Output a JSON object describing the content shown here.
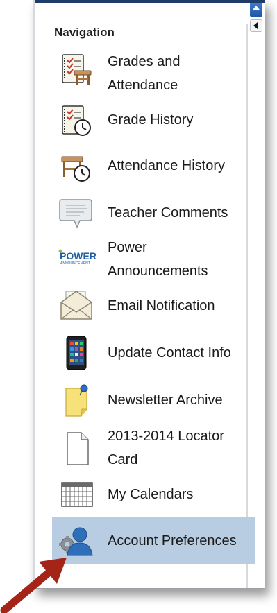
{
  "panel": {
    "title": "Navigation",
    "scroll_up_label": "",
    "items": [
      {
        "id": "grades-and-attendance",
        "icon": "gradebook-desk-icon",
        "label_line1": "Grades and",
        "label_line2": "Attendance"
      },
      {
        "id": "grade-history",
        "icon": "gradebook-clock-icon",
        "label": "Grade History"
      },
      {
        "id": "attendance-history",
        "icon": "desk-clock-icon",
        "label": "Attendance History"
      },
      {
        "id": "teacher-comments",
        "icon": "speech-note-icon",
        "label": "Teacher Comments"
      },
      {
        "id": "power-announcements",
        "icon": "power-announcement-logo-icon",
        "label_line1": "Power",
        "label_line2": "Announcements",
        "logo_text": "POWER",
        "logo_subtext": "ANNOUNCEMENT"
      },
      {
        "id": "email-notification",
        "icon": "envelope-icon",
        "label": "Email Notification"
      },
      {
        "id": "update-contact-info",
        "icon": "smartphone-icon",
        "label": "Update Contact Info"
      },
      {
        "id": "newsletter-archive",
        "icon": "sticky-note-pin-icon",
        "label": "Newsletter Archive"
      },
      {
        "id": "locator-card",
        "icon": "blank-document-icon",
        "label_line1": "2013-2014 Locator",
        "label_line2": "Card"
      },
      {
        "id": "my-calendars",
        "icon": "calendar-grid-icon",
        "label": "My Calendars"
      },
      {
        "id": "account-preferences",
        "icon": "user-gear-icon",
        "label": "Account Preferences",
        "selected": true
      }
    ]
  },
  "colors": {
    "selected_bg": "#b9cde2",
    "top_bar": "#1f3c6a",
    "pointer_arrow": "#a52418"
  }
}
